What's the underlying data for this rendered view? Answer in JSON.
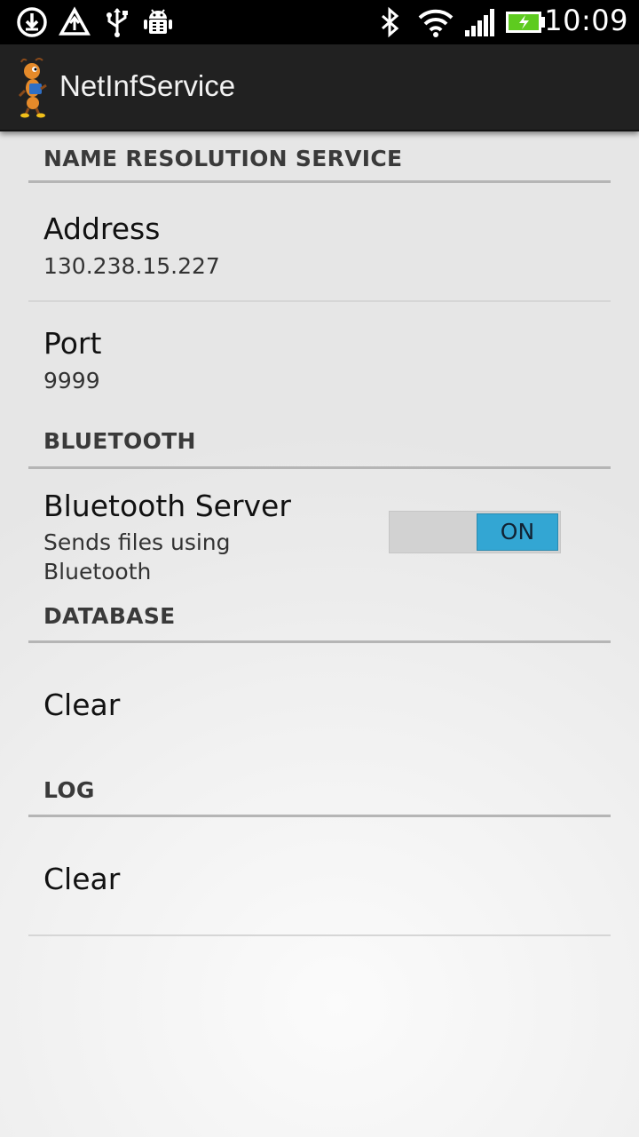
{
  "status_bar": {
    "time": "10:09",
    "left_icons": [
      "download-sync-icon",
      "data-transfer-icon",
      "usb-icon",
      "android-debug-icon"
    ],
    "right_icons": [
      "bluetooth-icon",
      "wifi-icon",
      "signal-icon",
      "battery-charging-icon"
    ],
    "battery_color": "#5ecb1f"
  },
  "action_bar": {
    "title": "NetInfService",
    "icon": "ant-mascot-icon"
  },
  "sections": {
    "nrs": {
      "header": "NAME RESOLUTION SERVICE",
      "address": {
        "title": "Address",
        "summary": "130.238.15.227"
      },
      "port": {
        "title": "Port",
        "summary": "9999"
      }
    },
    "bluetooth": {
      "header": "BLUETOOTH",
      "server": {
        "title": "Bluetooth Server",
        "summary": "Sends files using Bluetooth",
        "toggle_label": "ON"
      }
    },
    "database": {
      "header": "DATABASE",
      "clear": {
        "title": "Clear"
      }
    },
    "log": {
      "header": "LOG",
      "clear": {
        "title": "Clear"
      }
    }
  },
  "colors": {
    "accent": "#33a6d3",
    "action_bar": "#212121"
  }
}
